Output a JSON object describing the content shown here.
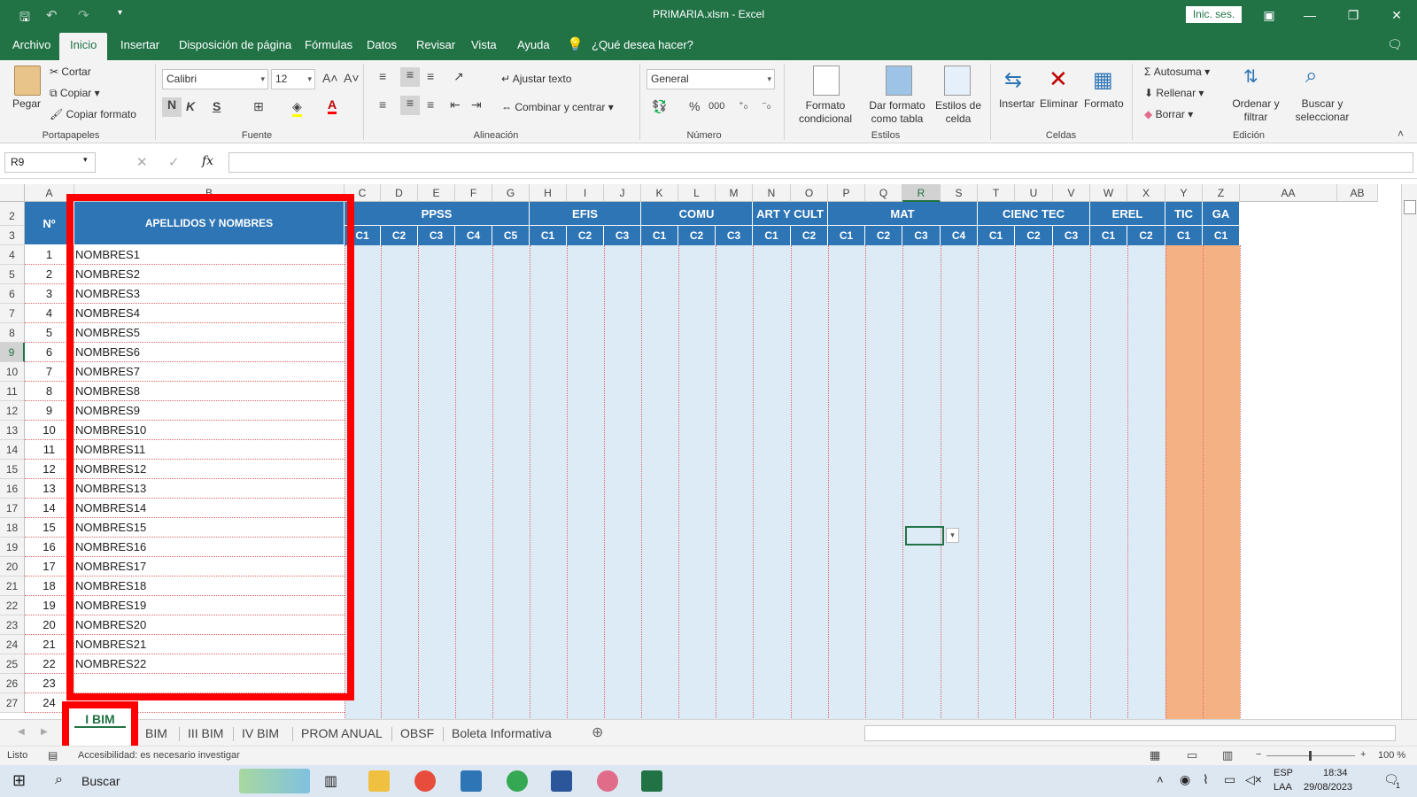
{
  "window": {
    "title": "PRIMARIA.xlsm  -  Excel",
    "signin": "Inic. ses."
  },
  "ribbon_tabs": [
    {
      "label": "Archivo"
    },
    {
      "label": "Inicio"
    },
    {
      "label": "Insertar"
    },
    {
      "label": "Disposición de página"
    },
    {
      "label": "Fórmulas"
    },
    {
      "label": "Datos"
    },
    {
      "label": "Revisar"
    },
    {
      "label": "Vista"
    },
    {
      "label": "Ayuda"
    }
  ],
  "tell_me": "¿Qué desea hacer?",
  "clipboard": {
    "paste": "Pegar",
    "cut": "Cortar",
    "copy": "Copiar",
    "format_painter": "Copiar formato",
    "group": "Portapapeles"
  },
  "font": {
    "name": "Calibri",
    "size": "12",
    "bold": "N",
    "italic": "K",
    "underline": "S",
    "group": "Fuente"
  },
  "alignment": {
    "wrap": "Ajustar texto",
    "merge": "Combinar y centrar",
    "group": "Alineación"
  },
  "number": {
    "format": "General",
    "percent": "%",
    "thousands": "000",
    "group": "Número"
  },
  "styles": {
    "cond": [
      "Formato",
      "condicional"
    ],
    "table": [
      "Dar formato",
      "como tabla"
    ],
    "cell": [
      "Estilos de",
      "celda"
    ],
    "group": "Estilos"
  },
  "cells": {
    "insert": "Insertar",
    "delete": "Eliminar",
    "format": "Formato",
    "group": "Celdas"
  },
  "editing": {
    "autosum": "Autosuma",
    "fill": "Rellenar",
    "clear": "Borrar",
    "sort": [
      "Ordenar y",
      "filtrar"
    ],
    "find": [
      "Buscar y",
      "seleccionar"
    ],
    "group": "Edición"
  },
  "namebox": "R9",
  "fx": "fx",
  "columns": [
    {
      "l": "A",
      "w": 56
    },
    {
      "l": "B",
      "w": 305
    },
    {
      "l": "C",
      "w": 41
    },
    {
      "l": "D",
      "w": 42
    },
    {
      "l": "E",
      "w": 42
    },
    {
      "l": "F",
      "w": 42
    },
    {
      "l": "G",
      "w": 42
    },
    {
      "l": "H",
      "w": 42
    },
    {
      "l": "I",
      "w": 42
    },
    {
      "l": "J",
      "w": 42
    },
    {
      "l": "K",
      "w": 42
    },
    {
      "l": "L",
      "w": 42
    },
    {
      "l": "M",
      "w": 42
    },
    {
      "l": "N",
      "w": 43
    },
    {
      "l": "O",
      "w": 42
    },
    {
      "l": "P",
      "w": 42
    },
    {
      "l": "Q",
      "w": 42
    },
    {
      "l": "R",
      "w": 43
    },
    {
      "l": "S",
      "w": 42
    },
    {
      "l": "T",
      "w": 42
    },
    {
      "l": "U",
      "w": 43
    },
    {
      "l": "V",
      "w": 42
    },
    {
      "l": "W",
      "w": 42
    },
    {
      "l": "X",
      "w": 43
    },
    {
      "l": "Y",
      "w": 42
    },
    {
      "l": "Z",
      "w": 42
    },
    {
      "l": "AA",
      "w": 110
    },
    {
      "l": "AB",
      "w": 46
    }
  ],
  "header": {
    "num": "Nº",
    "names": "APELLIDOS Y NOMBRES"
  },
  "groups": [
    {
      "label": "PPSS",
      "from": 2,
      "span": 5
    },
    {
      "label": "EFIS",
      "from": 7,
      "span": 3
    },
    {
      "label": "COMU",
      "from": 10,
      "span": 3
    },
    {
      "label": "ART Y CULT",
      "from": 13,
      "span": 2
    },
    {
      "label": "MAT",
      "from": 15,
      "span": 4
    },
    {
      "label": "CIENC TEC",
      "from": 19,
      "span": 3
    },
    {
      "label": "EREL",
      "from": 22,
      "span": 2
    },
    {
      "label": "TIC",
      "from": 24,
      "span": 1
    },
    {
      "label": "GA",
      "from": 25,
      "span": 1
    }
  ],
  "subheaders": [
    "C1",
    "C2",
    "C3",
    "C4",
    "C5",
    "C1",
    "C2",
    "C3",
    "C1",
    "C2",
    "C3",
    "C1",
    "C2",
    "C1",
    "C2",
    "C3",
    "C4",
    "C1",
    "C2",
    "C3",
    "C1",
    "C2",
    "C1",
    "C1"
  ],
  "row_labels": [
    "2",
    "3",
    "4",
    "5",
    "6",
    "7",
    "8",
    "9",
    "10",
    "11",
    "12",
    "13",
    "14",
    "15",
    "16",
    "17",
    "18",
    "19",
    "20",
    "21",
    "22",
    "23",
    "24",
    "25",
    "26",
    "27"
  ],
  "students": [
    {
      "n": "1",
      "name": "NOMBRES1"
    },
    {
      "n": "2",
      "name": "NOMBRES2"
    },
    {
      "n": "3",
      "name": "NOMBRES3"
    },
    {
      "n": "4",
      "name": "NOMBRES4"
    },
    {
      "n": "5",
      "name": "NOMBRES5"
    },
    {
      "n": "6",
      "name": "NOMBRES6"
    },
    {
      "n": "7",
      "name": "NOMBRES7"
    },
    {
      "n": "8",
      "name": "NOMBRES8"
    },
    {
      "n": "9",
      "name": "NOMBRES9"
    },
    {
      "n": "10",
      "name": "NOMBRES10"
    },
    {
      "n": "11",
      "name": "NOMBRES11"
    },
    {
      "n": "12",
      "name": "NOMBRES12"
    },
    {
      "n": "13",
      "name": "NOMBRES13"
    },
    {
      "n": "14",
      "name": "NOMBRES14"
    },
    {
      "n": "15",
      "name": "NOMBRES15"
    },
    {
      "n": "16",
      "name": "NOMBRES16"
    },
    {
      "n": "17",
      "name": "NOMBRES17"
    },
    {
      "n": "18",
      "name": "NOMBRES18"
    },
    {
      "n": "19",
      "name": "NOMBRES19"
    },
    {
      "n": "20",
      "name": "NOMBRES20"
    },
    {
      "n": "21",
      "name": "NOMBRES21"
    },
    {
      "n": "22",
      "name": "NOMBRES22"
    },
    {
      "n": "23",
      "name": ""
    },
    {
      "n": "24",
      "name": ""
    }
  ],
  "sheets": [
    "I BIM",
    "BIM",
    "III BIM",
    "IV BIM",
    "PROM ANUAL",
    "OBSF",
    "Boleta Informativa"
  ],
  "status": {
    "ready": "Listo",
    "accessibility": "Accesibilidad: es necesario investigar",
    "zoom": "100 %"
  },
  "taskbar": {
    "search": "Buscar",
    "lang1": "ESP",
    "lang2": "LAA",
    "time": "18:34",
    "date": "29/08/2023",
    "notif": "1"
  },
  "colors": {
    "excel_green": "#217346",
    "header_blue": "#2e75b6",
    "data_bg": "#ddebf7",
    "tic_bg": "#f4b183",
    "highlight": "#ff0000"
  }
}
